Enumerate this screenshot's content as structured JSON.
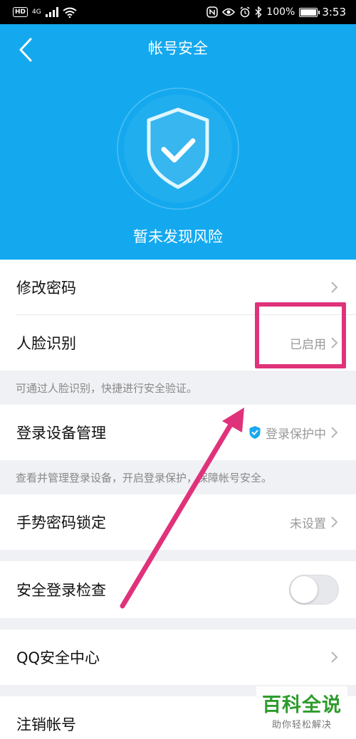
{
  "status_bar": {
    "hd": "HD",
    "network": "4G",
    "battery": "100%",
    "time": "3:53",
    "battery_level": 1.0
  },
  "header": {
    "title": "帐号安全",
    "status": "暂未发现风险",
    "accent_color": "#14a9ef"
  },
  "items": {
    "change_password": {
      "label": "修改密码"
    },
    "face_recognition": {
      "label": "人脸识别",
      "value": "已启用",
      "hint": "可通过人脸识别，快捷进行安全验证。"
    },
    "device_management": {
      "label": "登录设备管理",
      "value": "登录保护中",
      "hint": "查看并管理登录设备，开启登录保护，保障帐号安全。"
    },
    "gesture_lock": {
      "label": "手势密码锁定",
      "value": "未设置"
    },
    "safe_login_check": {
      "label": "安全登录检查",
      "enabled": false
    },
    "qq_security_center": {
      "label": "QQ安全中心"
    },
    "deregister": {
      "label": "注销帐号"
    }
  },
  "annotation": {
    "color": "#e0327a"
  },
  "watermark": {
    "title": "百科全说",
    "subtitle": "助你轻松解决"
  }
}
